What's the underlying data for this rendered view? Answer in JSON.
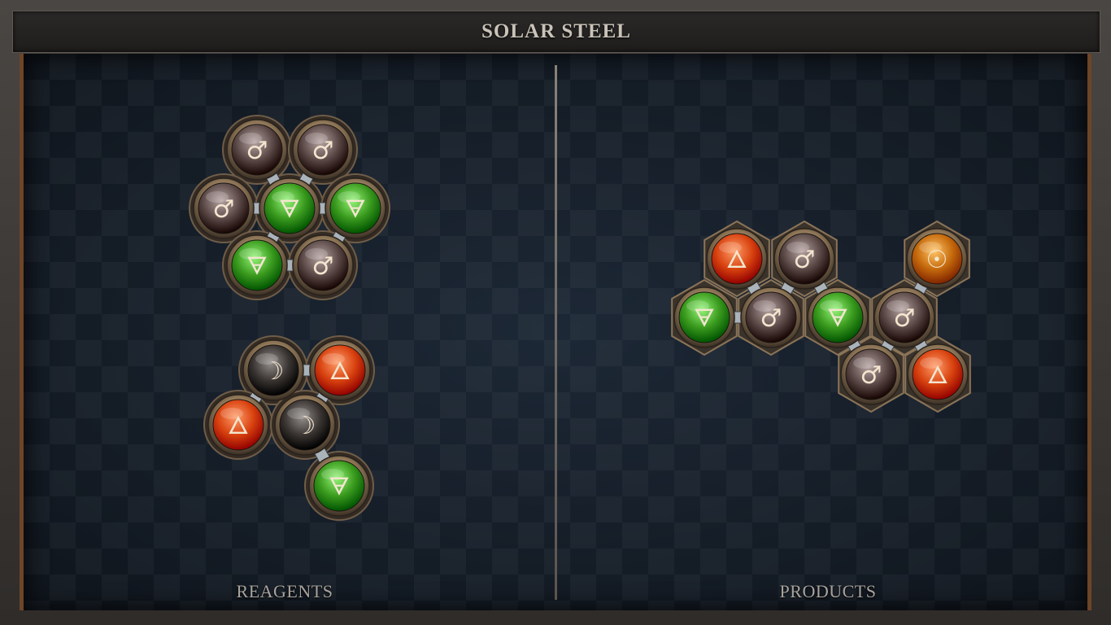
{
  "title": "SOLAR STEEL",
  "panels": {
    "reagents_label": "REAGENTS",
    "products_label": "PRODUCTS"
  },
  "element_symbols": {
    "iron": "♂",
    "earth": "🜃",
    "fire": "🜂",
    "silver": "☽",
    "gold": "☉"
  },
  "element_colors": {
    "iron": "#5c4a48",
    "earth": "#3a9a1e",
    "fire": "#d8420f",
    "silver": "#3a3532",
    "gold": "#c56a0c"
  },
  "molecules": [
    {
      "group": "reagent",
      "atoms": [
        {
          "id": "r1a1",
          "element": "iron",
          "col": 0,
          "row": 0
        },
        {
          "id": "r1a2",
          "element": "iron",
          "col": 1,
          "row": 0
        },
        {
          "id": "r1a3",
          "element": "iron",
          "col": 0,
          "row": 1
        },
        {
          "id": "r1a4",
          "element": "earth",
          "col": 1,
          "row": 1
        },
        {
          "id": "r1a5",
          "element": "earth",
          "col": 2,
          "row": 1
        },
        {
          "id": "r1a6",
          "element": "earth",
          "col": 0,
          "row": 2
        },
        {
          "id": "r1a7",
          "element": "iron",
          "col": 1,
          "row": 2
        }
      ],
      "bonds": [
        [
          "r1a1",
          "r1a4"
        ],
        [
          "r1a2",
          "r1a4"
        ],
        [
          "r1a3",
          "r1a4"
        ],
        [
          "r1a4",
          "r1a5"
        ],
        [
          "r1a4",
          "r1a6"
        ],
        [
          "r1a5",
          "r1a7"
        ],
        [
          "r1a6",
          "r1a7"
        ]
      ]
    },
    {
      "group": "reagent",
      "atoms": [
        {
          "id": "r2a1",
          "element": "silver",
          "col": 0,
          "row": 0
        },
        {
          "id": "r2a2",
          "element": "fire",
          "col": 1,
          "row": 0
        },
        {
          "id": "r2a3",
          "element": "fire",
          "col": -1,
          "row": 1
        },
        {
          "id": "r2a4",
          "element": "silver",
          "col": 0,
          "row": 1
        },
        {
          "id": "r2a5",
          "element": "earth",
          "col": 0,
          "row": 2
        }
      ],
      "bonds": [
        [
          "r2a1",
          "r2a2"
        ],
        [
          "r2a1",
          "r2a3"
        ],
        [
          "r2a2",
          "r2a4"
        ],
        [
          "r2a4",
          "r2a5"
        ]
      ]
    },
    {
      "group": "product",
      "atoms": [
        {
          "id": "p1",
          "element": "fire",
          "col": 0,
          "row": 0
        },
        {
          "id": "p2",
          "element": "iron",
          "col": 1,
          "row": 0
        },
        {
          "id": "p3",
          "element": "gold",
          "col": 3,
          "row": 0
        },
        {
          "id": "p4",
          "element": "earth",
          "col": -1,
          "row": 1
        },
        {
          "id": "p5",
          "element": "iron",
          "col": 0,
          "row": 1
        },
        {
          "id": "p6",
          "element": "earth",
          "col": 1,
          "row": 1
        },
        {
          "id": "p7",
          "element": "iron",
          "col": 2,
          "row": 1
        },
        {
          "id": "p8",
          "element": "iron",
          "col": 1,
          "row": 2
        },
        {
          "id": "p9",
          "element": "fire",
          "col": 2,
          "row": 2
        }
      ],
      "bonds": [
        [
          "p1",
          "p5"
        ],
        [
          "p2",
          "p5"
        ],
        [
          "p2",
          "p6"
        ],
        [
          "p4",
          "p5"
        ],
        [
          "p3",
          "p7"
        ],
        [
          "p6",
          "p8"
        ],
        [
          "p7",
          "p8"
        ],
        [
          "p7",
          "p9"
        ]
      ]
    }
  ]
}
